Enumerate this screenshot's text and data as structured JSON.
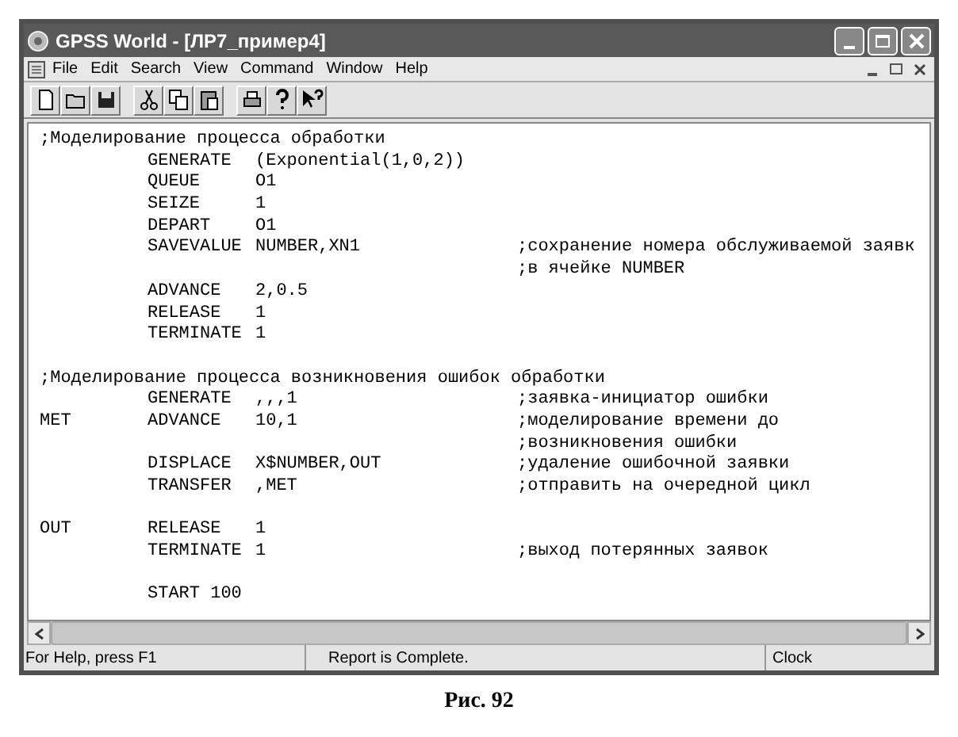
{
  "window": {
    "title": "GPSS World - [ЛР7_пример4]"
  },
  "menu": [
    "File",
    "Edit",
    "Search",
    "View",
    "Command",
    "Window",
    "Help"
  ],
  "editor": {
    "lines": [
      {
        "kind": "comment",
        "text": ";Моделирование процесса обработки"
      },
      {
        "kind": "statement",
        "operation": "GENERATE",
        "operand": "(Exponential(1,0,2))"
      },
      {
        "kind": "statement",
        "operation": "QUEUE",
        "operand": "O1"
      },
      {
        "kind": "statement",
        "operation": "SEIZE",
        "operand": "1"
      },
      {
        "kind": "statement",
        "operation": "DEPART",
        "operand": "O1"
      },
      {
        "kind": "statement",
        "operation": "SAVEVALUE",
        "operand": "NUMBER,XN1",
        "comment": ";сохранение номера обслуживаемой заявк"
      },
      {
        "kind": "statement",
        "comment": ";в ячейке NUMBER"
      },
      {
        "kind": "statement",
        "operation": "ADVANCE",
        "operand": "2,0.5"
      },
      {
        "kind": "statement",
        "operation": "RELEASE",
        "operand": "1"
      },
      {
        "kind": "statement",
        "operation": "TERMINATE",
        "operand": "1"
      },
      {
        "kind": "blank"
      },
      {
        "kind": "comment",
        "text": ";Моделирование процесса возникновения ошибок обработки"
      },
      {
        "kind": "statement",
        "operation": "GENERATE",
        "operand": ",,,1",
        "comment": ";заявка-инициатор ошибки"
      },
      {
        "kind": "statement",
        "label": "MET",
        "operation": "ADVANCE",
        "operand": "10,1",
        "comment": ";моделирование времени до"
      },
      {
        "kind": "statement",
        "comment": ";возникновения ошибки"
      },
      {
        "kind": "statement",
        "operation": "DISPLACE",
        "operand": "X$NUMBER,OUT",
        "comment": ";удаление ошибочной заявки"
      },
      {
        "kind": "statement",
        "operation": "TRANSFER",
        "operand": ",MET",
        "comment": ";отправить на очередной цикл"
      },
      {
        "kind": "blank"
      },
      {
        "kind": "statement",
        "label": "OUT",
        "operation": "RELEASE",
        "operand": "1"
      },
      {
        "kind": "statement",
        "operation": "TERMINATE",
        "operand": "1",
        "comment": ";выход потерянных заявок"
      },
      {
        "kind": "blank"
      },
      {
        "kind": "statement",
        "operation": "START 100"
      }
    ]
  },
  "status_bar": [
    "For Help, press F1",
    "Report is Complete.",
    "Clock"
  ],
  "caption": "Рис. 92"
}
